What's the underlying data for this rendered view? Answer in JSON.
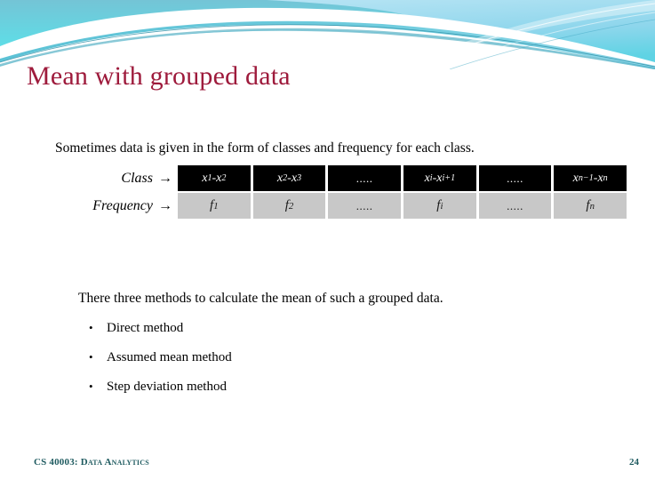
{
  "slide": {
    "title": "Mean with grouped data",
    "title_color": "#9E1B3C",
    "intro": "Sometimes data is given in the form of classes and frequency for each class.",
    "methods_intro": "There three methods to calculate the mean of such a grouped data.",
    "bullet_marker": "•"
  },
  "table": {
    "row_labels": {
      "class": "Class",
      "frequency": "Frequency"
    },
    "arrow": "→",
    "class_row": [
      {
        "base1": "x",
        "sub1": "1",
        "sep": "- ",
        "base2": "x",
        "sub2": "2",
        "dots": ""
      },
      {
        "base1": "x",
        "sub1": "2",
        "sep": "- ",
        "base2": "x",
        "sub2": "3",
        "dots": ""
      },
      {
        "base1": "",
        "sub1": "",
        "sep": "",
        "base2": "",
        "sub2": "",
        "dots": "....."
      },
      {
        "base1": "x",
        "sub1": "i",
        "sep": "- ",
        "base2": "x",
        "sub2": "i+1",
        "dots": ""
      },
      {
        "base1": "",
        "sub1": "",
        "sep": "",
        "base2": "",
        "sub2": "",
        "dots": "....."
      },
      {
        "base1": "x",
        "sub1": "n−1",
        "sep": "- ",
        "base2": "x",
        "sub2": "n",
        "dots": ""
      }
    ],
    "frequency_row": [
      {
        "base1": "f",
        "sub1": "1",
        "dots": ""
      },
      {
        "base1": "f",
        "sub1": "2",
        "dots": ""
      },
      {
        "base1": "",
        "sub1": "",
        "dots": "....."
      },
      {
        "base1": "f",
        "sub1": "i",
        "dots": ""
      },
      {
        "base1": "",
        "sub1": "",
        "dots": "....."
      },
      {
        "base1": "f",
        "sub1": "n",
        "dots": ""
      }
    ],
    "class_cell_bg": "#000000",
    "class_cell_fg": "#FFFFFF",
    "frequency_cell_bg": "#C8C8C8",
    "frequency_cell_fg": "#1A1A1A"
  },
  "methods": [
    {
      "label": "Direct method"
    },
    {
      "label": "Assumed mean method"
    },
    {
      "label": "Step deviation method"
    }
  ],
  "footer": {
    "course": "CS 40003: Data Analytics",
    "page_number": "24",
    "color": "#1F5B60"
  },
  "theme": {
    "banner_cyan": "#5FE0E8",
    "banner_teal": "#6BC5D8",
    "banner_light_blue": "#A8DCF0",
    "banner_deep_teal": "#2E9CB5"
  }
}
